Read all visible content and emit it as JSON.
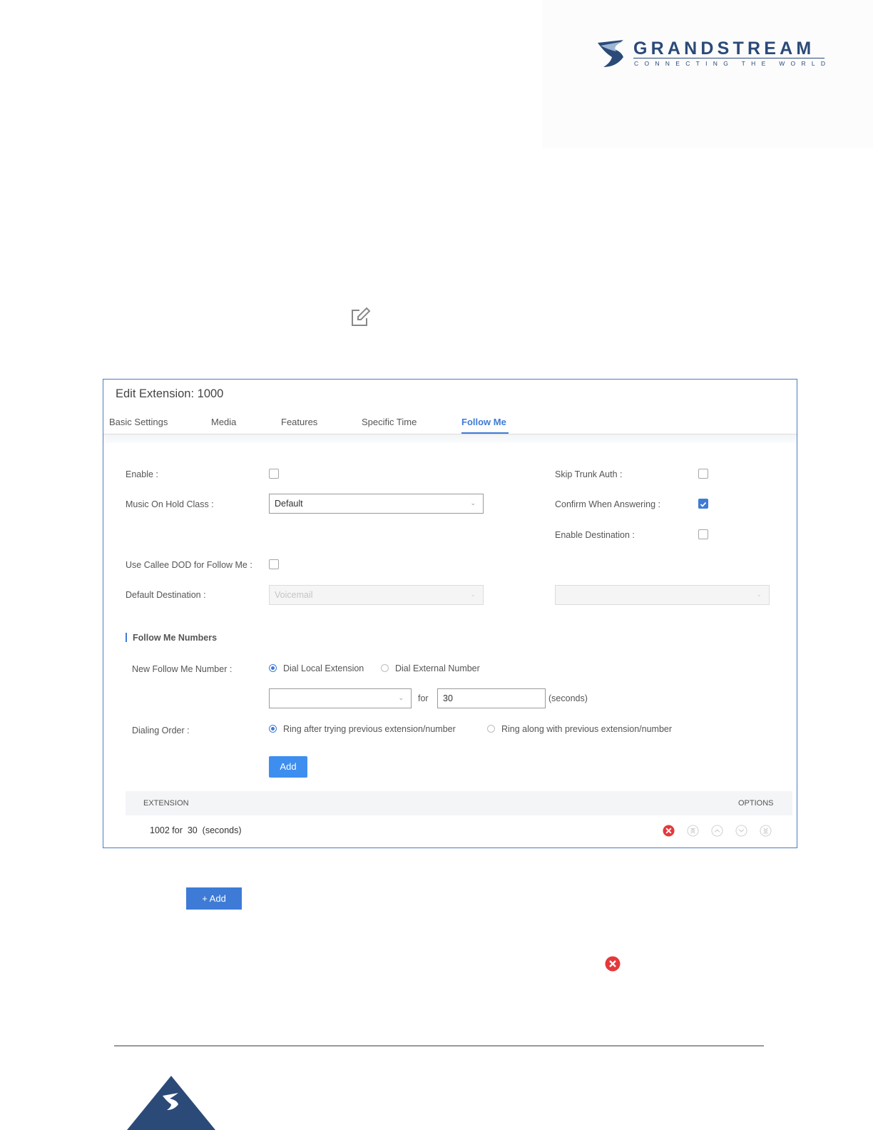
{
  "brand": {
    "name": "GRANDSTREAM",
    "tagline": "CONNECTING THE WORLD",
    "colors": {
      "primary": "#2b4a78",
      "accent": "#3e7bd6",
      "danger": "#e5383b"
    }
  },
  "icons": {
    "edit": "edit-icon",
    "delete": "close-circle-icon",
    "options": [
      "move-top-icon",
      "move-up-icon",
      "move-down-icon",
      "move-bottom-icon"
    ]
  },
  "panel": {
    "title": "Edit Extension: 1000",
    "tabs": [
      {
        "label": "Basic Settings"
      },
      {
        "label": "Media"
      },
      {
        "label": "Features"
      },
      {
        "label": "Specific Time"
      },
      {
        "label": "Follow Me",
        "active": true
      }
    ],
    "fields": {
      "enable": {
        "label": "Enable",
        "checked": false
      },
      "skip_trunk_auth": {
        "label": "Skip Trunk Auth",
        "checked": false
      },
      "music_on_hold": {
        "label": "Music On Hold Class",
        "value": "Default"
      },
      "confirm_answering": {
        "label": "Confirm When Answering",
        "checked": true
      },
      "enable_destination": {
        "label": "Enable Destination",
        "checked": false
      },
      "use_callee_dod": {
        "label": "Use Callee DOD for Follow Me",
        "checked": false
      },
      "default_destination": {
        "label": "Default Destination",
        "value": "Voicemail",
        "second_value": ""
      }
    },
    "section_title": "Follow Me Numbers",
    "new_number": {
      "label": "New Follow Me Number",
      "options": [
        {
          "label": "Dial Local Extension",
          "selected": true
        },
        {
          "label": "Dial External Number",
          "selected": false
        }
      ],
      "extension_value": "",
      "for_label": "for",
      "seconds_value": "30",
      "seconds_label": "(seconds)"
    },
    "dialing_order": {
      "label": "Dialing Order",
      "options": [
        {
          "label": "Ring after trying previous extension/number",
          "selected": true
        },
        {
          "label": "Ring along with previous extension/number",
          "selected": false
        }
      ]
    },
    "add_button": "Add",
    "table": {
      "headers": {
        "extension": "EXTENSION",
        "options": "OPTIONS"
      },
      "rows": [
        {
          "text": "1002 for  30  (seconds)"
        }
      ]
    }
  },
  "standalone_add_button": "+ Add"
}
